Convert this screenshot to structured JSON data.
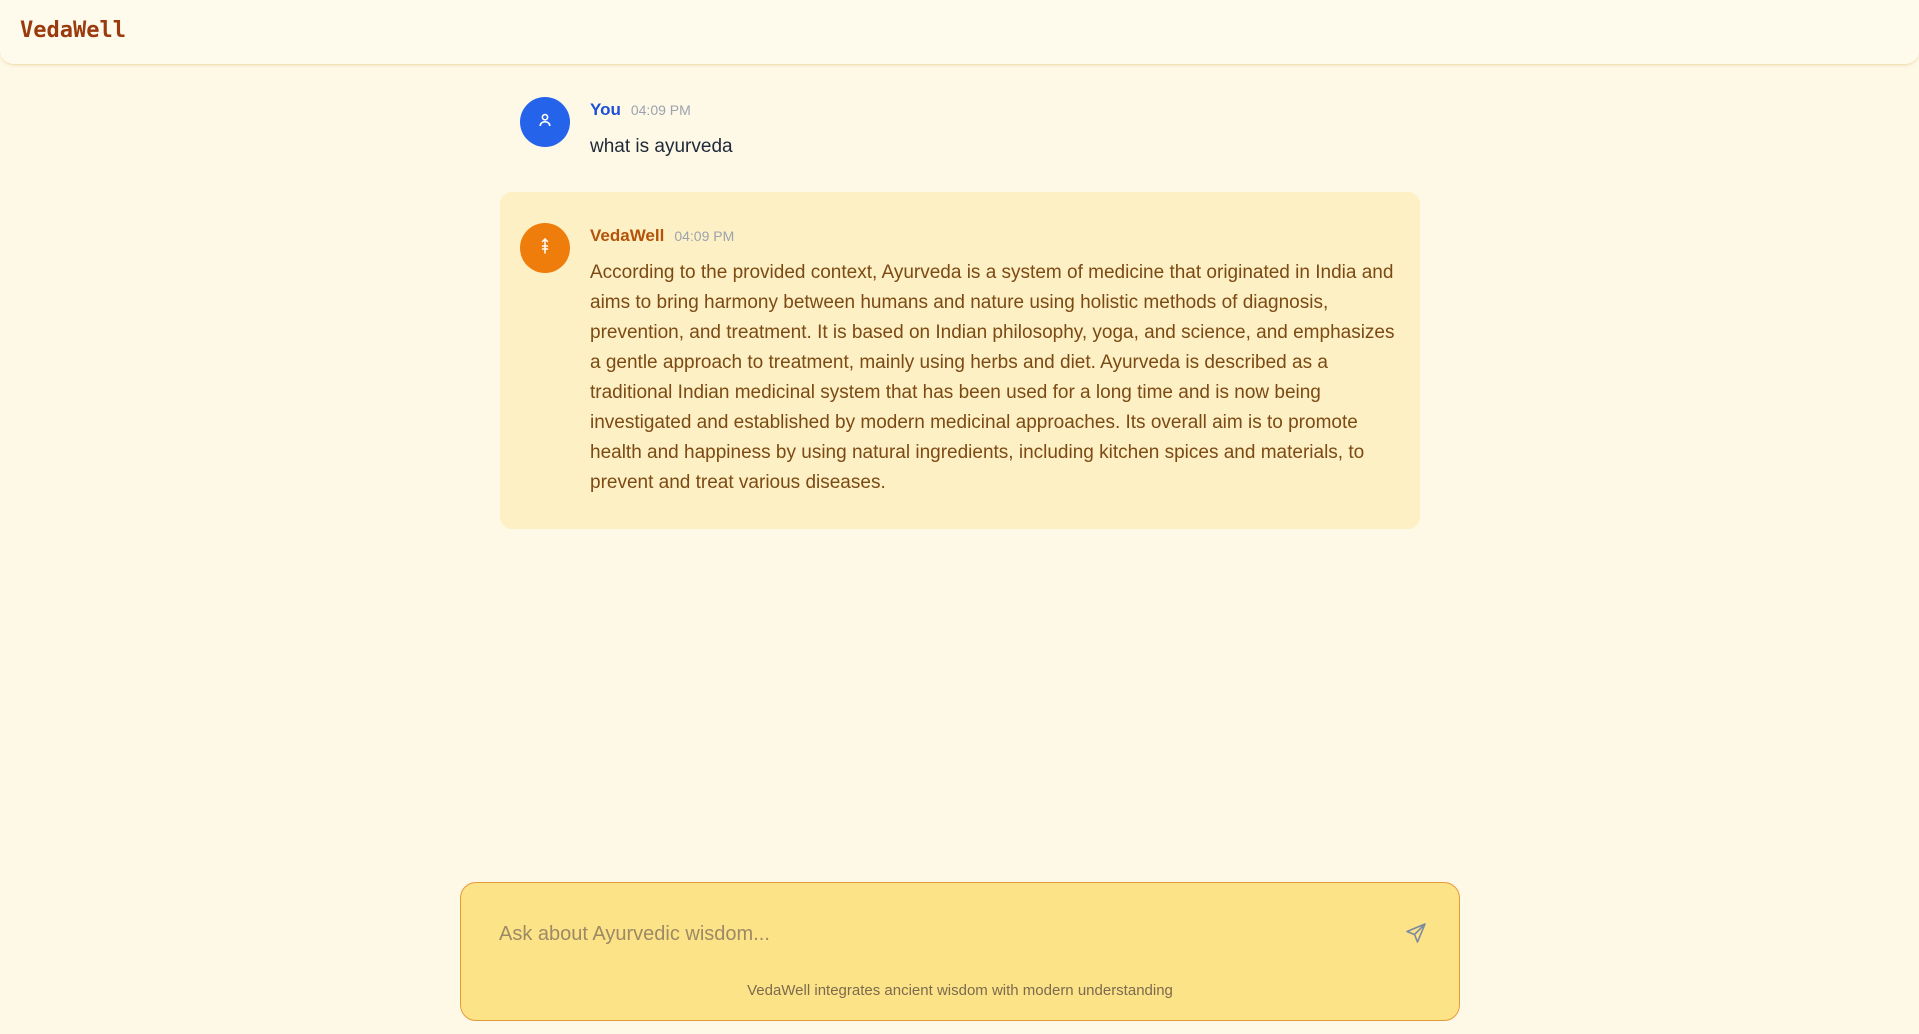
{
  "header": {
    "app_name": "VedaWell"
  },
  "messages": [
    {
      "sender": "You",
      "time": "04:09 PM",
      "text": "what is ayurveda",
      "avatar_icon": "user-icon",
      "accent": "#2563eb"
    },
    {
      "sender": "VedaWell",
      "time": "04:09 PM",
      "text": "According to the provided context, Ayurveda is a system of medicine that originated in India and aims to bring harmony between humans and nature using holistic methods of diagnosis, prevention, and treatment. It is based on Indian philosophy, yoga, and science, and emphasizes a gentle approach to treatment, mainly using herbs and diet. Ayurveda is described as a traditional Indian medicinal system that has been used for a long time and is now being investigated and established by modern medicinal approaches. Its overall aim is to promote health and happiness by using natural ingredients, including kitchen spices and materials, to prevent and treat various diseases.",
      "avatar_icon": "staff-icon",
      "accent": "#ee7d0b"
    }
  ],
  "composer": {
    "placeholder": "Ask about Ayurvedic wisdom...",
    "value": "",
    "send_icon": "send-icon",
    "footer_note": "VedaWell integrates ancient wisdom with modern understanding"
  },
  "colors": {
    "background": "#fef9e7",
    "bot_bubble": "#fdf0c4",
    "composer": "#fde388",
    "brand": "#9a3a0e"
  }
}
